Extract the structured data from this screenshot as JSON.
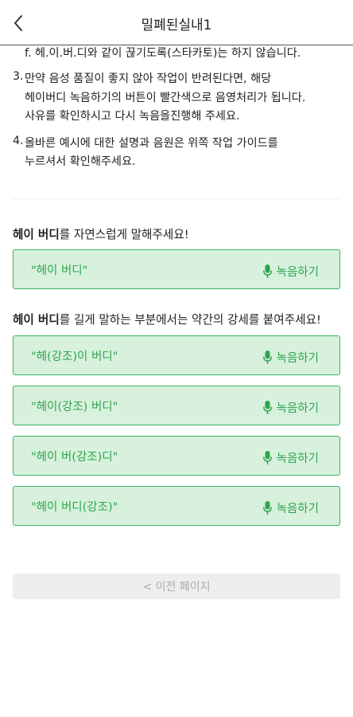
{
  "header": {
    "title": "밀폐된실내1"
  },
  "guide": {
    "line_f": "f. 헤.이.버.디와 같이 끊기도록(스타카토)는 하지 않습니다.",
    "item3": {
      "num": "3.",
      "lines": [
        "만약 음성 품질이 좋지 않아 작업이 반려된다면, 해당",
        "헤이버디 녹음하기의 버튼이 빨간색으로 음영처리가 됩니다.",
        "사유를 확인하시고 다시 녹음을진행해 주세요."
      ]
    },
    "item4": {
      "num": "4.",
      "lines": [
        "올바른 예시에 대한 설명과 음원은 위쪽 작업 가이드를",
        "누르셔서 확인해주세요."
      ]
    }
  },
  "section1": {
    "bold": "헤이 버디",
    "rest": "를 자연스럽게 말해주세요!",
    "cards": [
      {
        "phrase": "\"헤이 버디\"",
        "action": "녹음하기"
      }
    ]
  },
  "section2": {
    "bold": "헤이 버디",
    "rest": "를 길게 말하는 부분에서는 약간의 강세를 붙여주세요!",
    "cards": [
      {
        "phrase": "\"헤(강조)이 버디\"",
        "action": "녹음하기"
      },
      {
        "phrase": "\"헤이(강조) 버디\"",
        "action": "녹음하기"
      },
      {
        "phrase": "\"헤이 버(강조)디\"",
        "action": "녹음하기"
      },
      {
        "phrase": "\"헤이 버디(강조)\"",
        "action": "녹음하기"
      }
    ]
  },
  "footer": {
    "prev_label": "< 이전 페이지"
  },
  "colors": {
    "accent": "#2fa44f",
    "card_bg": "#d7f1dc",
    "card_border": "#3bb560"
  },
  "icons": {
    "back": "chevron-left-icon",
    "mic": "microphone-icon"
  }
}
